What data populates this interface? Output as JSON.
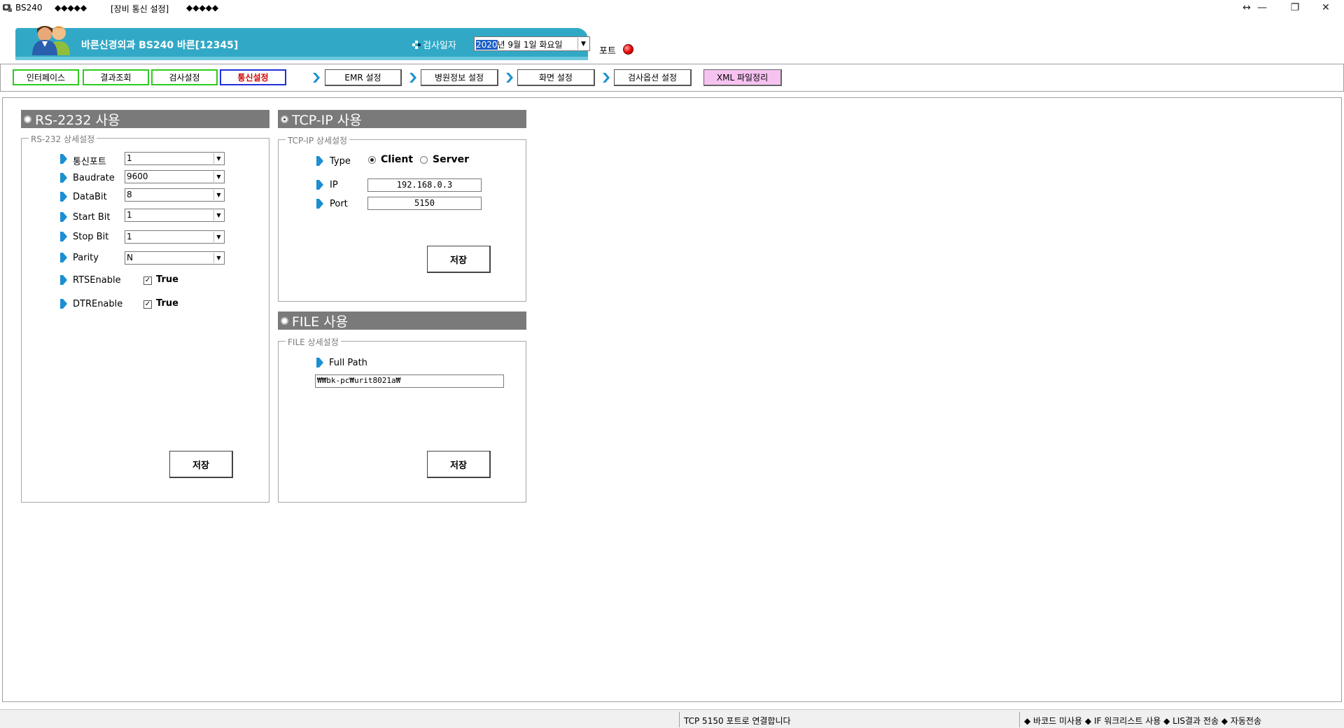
{
  "titlebar": {
    "app_name": "BS240",
    "segments": [
      "◆◆◆◆◆",
      "[장비 통신 설정]",
      "◆◆◆◆◆"
    ],
    "controls": [
      "↔",
      "—",
      "❐",
      "✕"
    ]
  },
  "header": {
    "title": "바른신경외과  BS240  바른[12345]",
    "date_label": "검사일자",
    "date_year": "2020",
    "date_rest": "년  9월  1일 화요일",
    "port_label": "포트",
    "port_status_color": "#e60000"
  },
  "tabs": [
    {
      "label": "인터페이스",
      "active": false
    },
    {
      "label": "결과조회",
      "active": false
    },
    {
      "label": "검사설정",
      "active": false
    },
    {
      "label": "통신설정",
      "active": true
    }
  ],
  "nav_buttons": [
    "EMR 설정",
    "병원정보 설정",
    "화면 설정",
    "검사옵션 설정",
    "XML 파일정리"
  ],
  "rs232": {
    "header": "RS-2232 사용",
    "group_title": "RS-232 상세설정",
    "fields": [
      {
        "label": "통신포트",
        "value": "1"
      },
      {
        "label": "Baudrate",
        "value": "9600"
      },
      {
        "label": "DataBit",
        "value": "8"
      },
      {
        "label": "Start Bit",
        "value": "1"
      },
      {
        "label": "Stop Bit",
        "value": "1"
      },
      {
        "label": "Parity",
        "value": "N"
      }
    ],
    "checks": [
      {
        "label": "RTSEnable",
        "checked": true,
        "text": "True"
      },
      {
        "label": "DTREnable",
        "checked": true,
        "text": "True"
      }
    ],
    "save_label": "저장"
  },
  "tcpip": {
    "header": "TCP-IP 사용",
    "group_title": "TCP-IP 상세설정",
    "type_label": "Type",
    "client_label": "Client",
    "server_label": "Server",
    "selected": "Client",
    "ip_label": "IP",
    "ip_value": "192.168.0.3",
    "port_label": "Port",
    "port_value": "5150",
    "save_label": "저장"
  },
  "file": {
    "header": "FILE 사용",
    "group_title": "FILE 상세설정",
    "path_label": "Full Path",
    "path_value": "₩₩bk-pc₩urit8021a₩",
    "save_label": "저장"
  },
  "statusbar": {
    "message": "TCP 5150 포트로 연결합니다",
    "flags": "◆ 바코드 미사용 ◆ IF 워크리스트 사용 ◆ LIS결과 전송 ◆ 자동전송"
  }
}
